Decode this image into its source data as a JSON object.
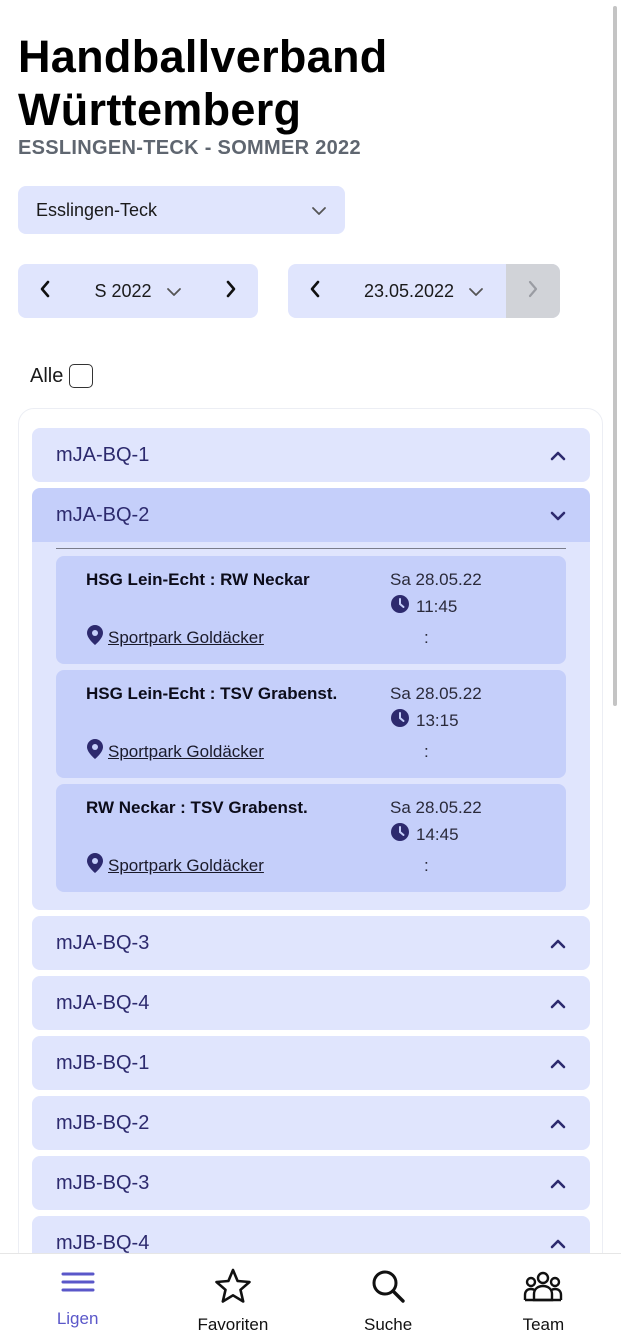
{
  "header": {
    "title_line1": "Handballverband",
    "title_line2": "Württemberg",
    "subtitle": "ESSLINGEN-TECK - SOMMER 2022"
  },
  "region_select": {
    "value": "Esslingen-Teck",
    "icon": "chevron-down-icon"
  },
  "season_picker": {
    "value": "S 2022"
  },
  "date_picker": {
    "value": "23.05.2022"
  },
  "filter": {
    "all_label": "Alle",
    "all_checked": false
  },
  "leagues": [
    {
      "label": "mJA-BQ-1",
      "expanded": false
    },
    {
      "label": "mJA-BQ-2",
      "expanded": true
    },
    {
      "label": "mJA-BQ-3",
      "expanded": false
    },
    {
      "label": "mJA-BQ-4",
      "expanded": false
    },
    {
      "label": "mJB-BQ-1",
      "expanded": false
    },
    {
      "label": "mJB-BQ-2",
      "expanded": false
    },
    {
      "label": "mJB-BQ-3",
      "expanded": false
    },
    {
      "label": "mJB-BQ-4",
      "expanded": false
    }
  ],
  "matches": [
    {
      "teams": "HSG Lein-Echt : RW Neckar",
      "date": "Sa 28.05.22",
      "time": "11:45",
      "venue": "Sportpark Goldäcker",
      "score": ":"
    },
    {
      "teams": "HSG Lein-Echt : TSV Grabenst.",
      "date": "Sa 28.05.22",
      "time": "13:15",
      "venue": "Sportpark Goldäcker",
      "score": ":"
    },
    {
      "teams": "RW Neckar : TSV Grabenst.",
      "date": "Sa 28.05.22",
      "time": "14:45",
      "venue": "Sportpark Goldäcker",
      "score": ":"
    }
  ],
  "bottom_nav": [
    {
      "label": "Ligen",
      "icon": "menu-icon",
      "active": true
    },
    {
      "label": "Favoriten",
      "icon": "star-icon",
      "active": false
    },
    {
      "label": "Suche",
      "icon": "search-icon",
      "active": false
    },
    {
      "label": "Team",
      "icon": "team-icon",
      "active": false
    }
  ],
  "colors": {
    "accent": "#5a57c9",
    "league_bg": "#e0e5fd",
    "league_open_bg": "#c5cffa",
    "league_text": "#2d2a6e",
    "icon_dark": "#2d2a6e"
  }
}
